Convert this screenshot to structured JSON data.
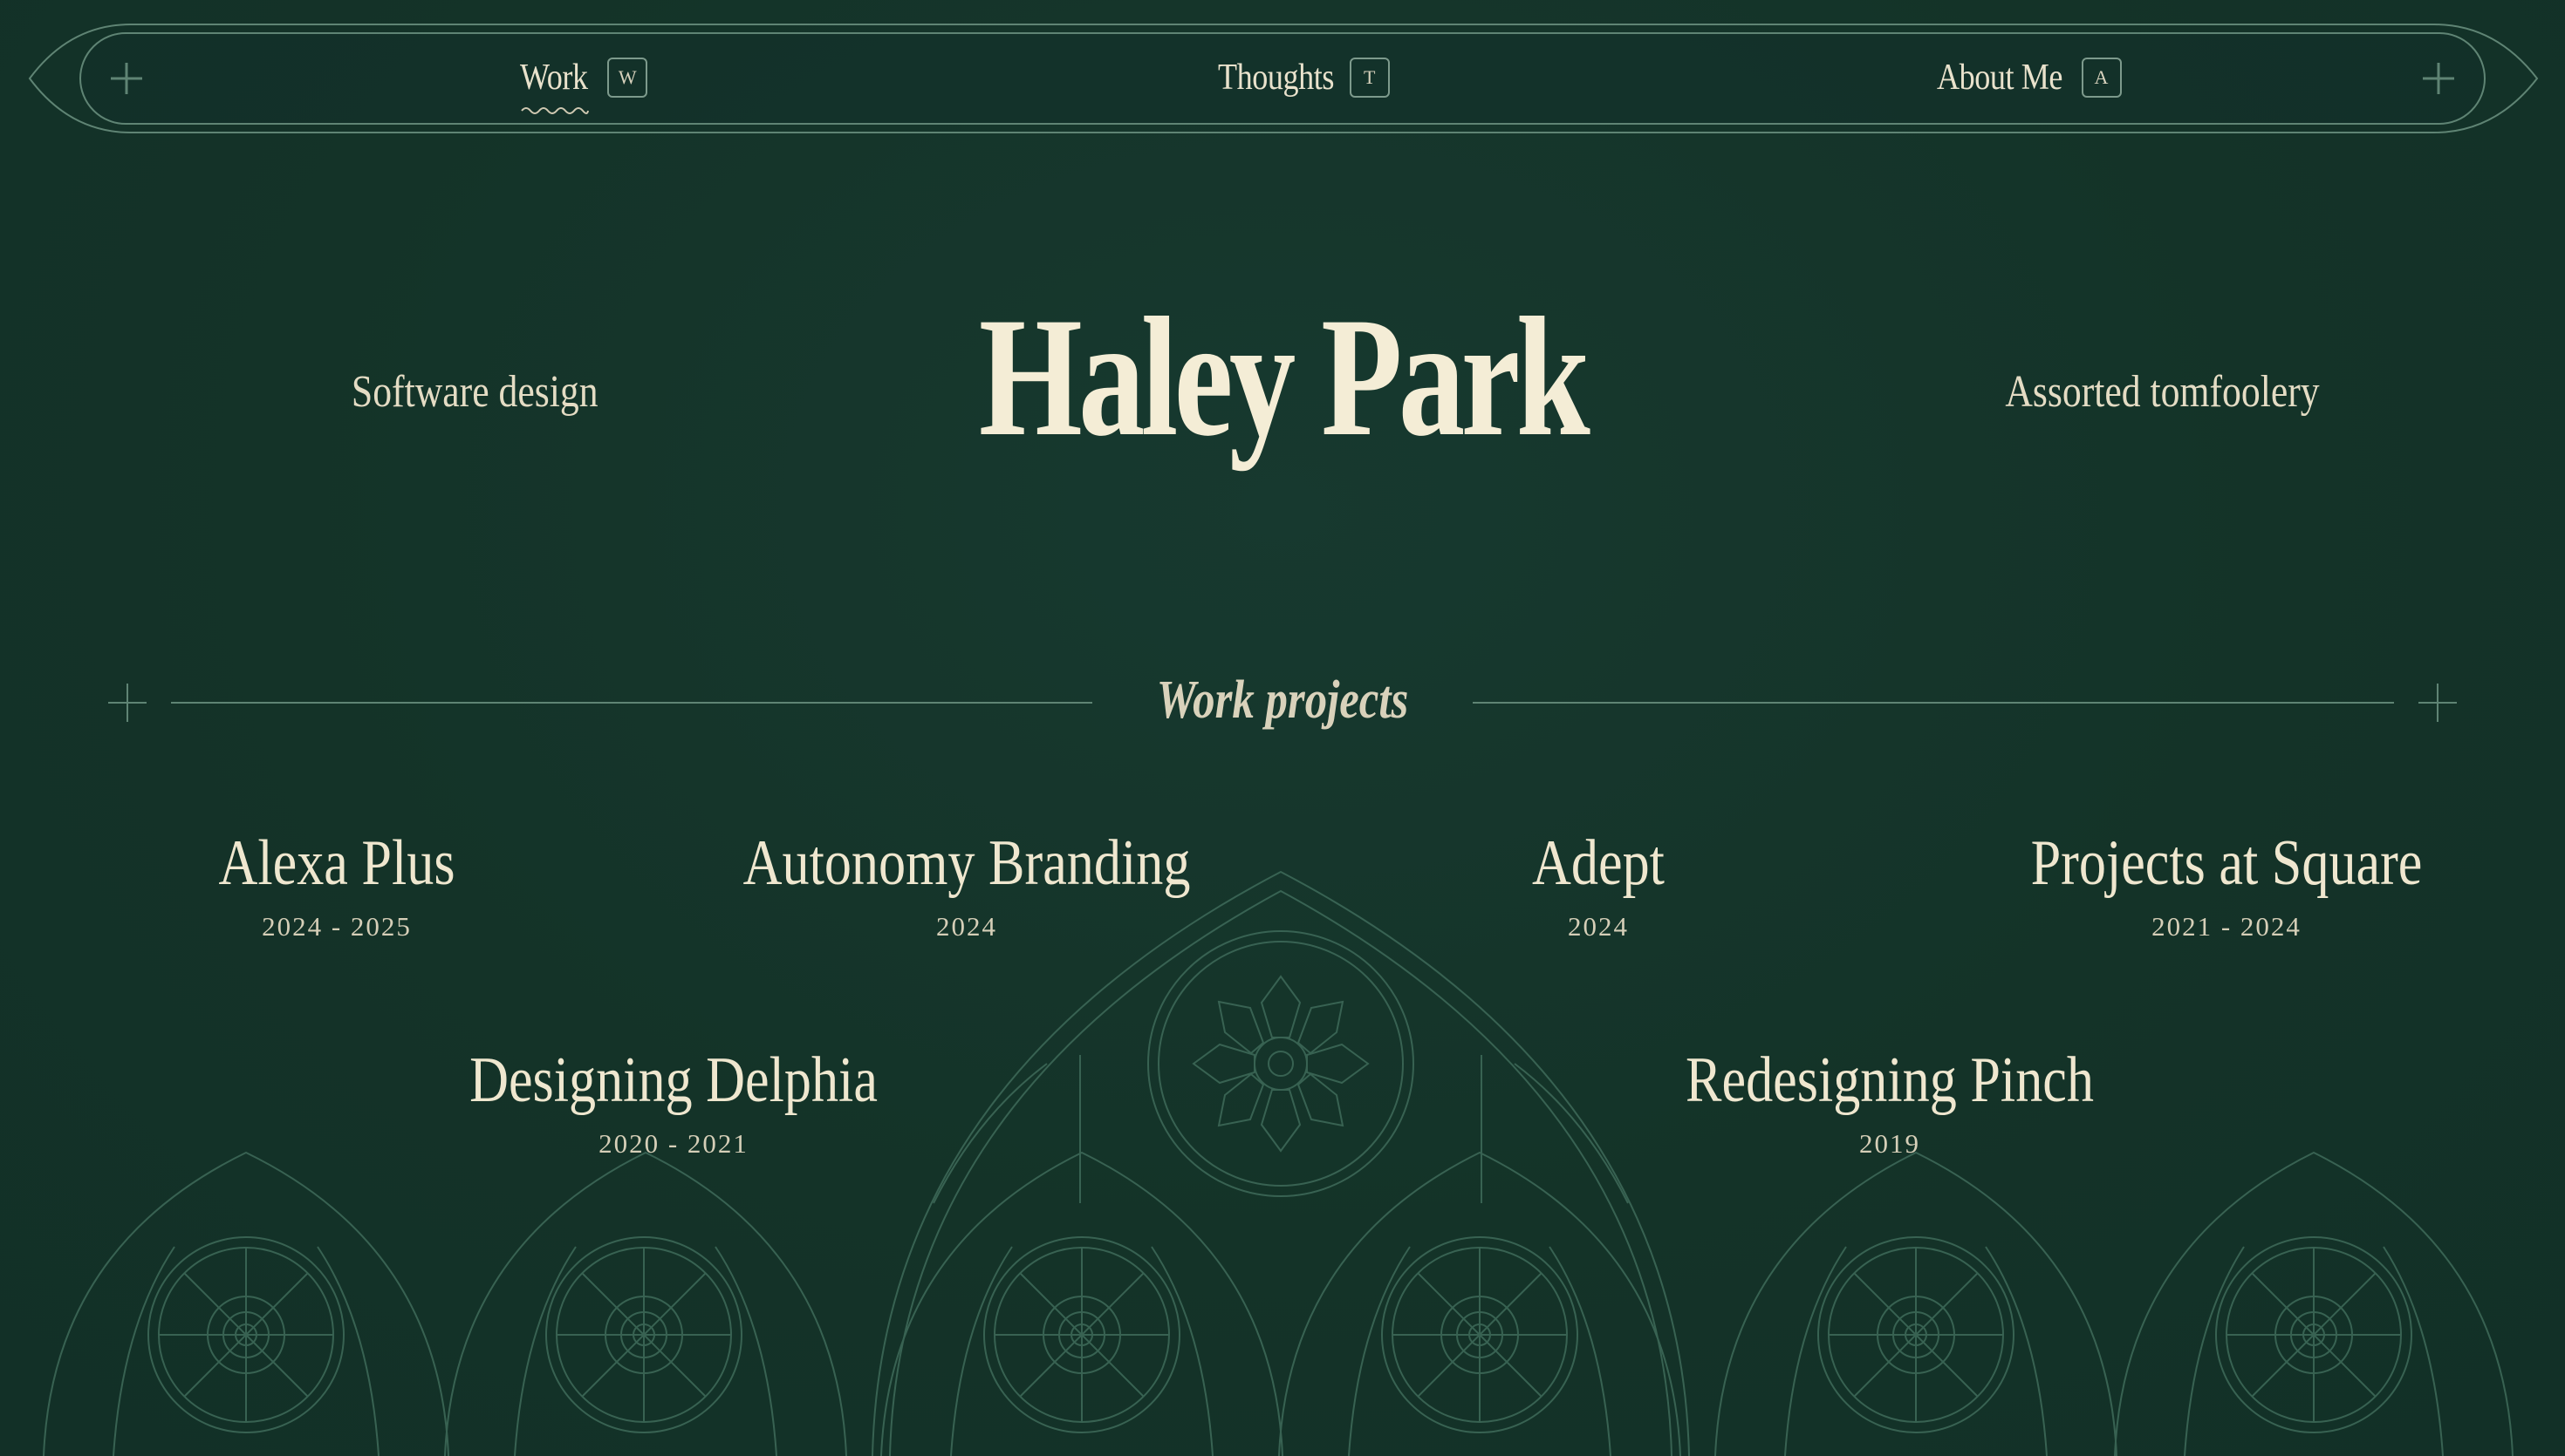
{
  "nav": {
    "items": [
      {
        "label": "Work",
        "key": "W",
        "active": true
      },
      {
        "label": "Thoughts",
        "key": "T",
        "active": false
      },
      {
        "label": "About Me",
        "key": "A",
        "active": false
      }
    ]
  },
  "hero": {
    "left_tagline": "Software design",
    "title": "Haley Park",
    "right_tagline": "Assorted tomfoolery"
  },
  "section": {
    "title": "Work projects"
  },
  "projects": [
    {
      "name": "Alexa Plus",
      "years": "2024 - 2025"
    },
    {
      "name": "Autonomy Branding",
      "years": "2024"
    },
    {
      "name": "Adept",
      "years": "2024"
    },
    {
      "name": "Projects at Square",
      "years": "2021 - 2024"
    },
    {
      "name": "Designing Delphia",
      "years": "2020 - 2021"
    },
    {
      "name": "Redesigning Pinch",
      "years": "2019"
    }
  ],
  "colors": {
    "background": "#143328",
    "text": "#f3ecd6",
    "line": "#5f8474"
  }
}
